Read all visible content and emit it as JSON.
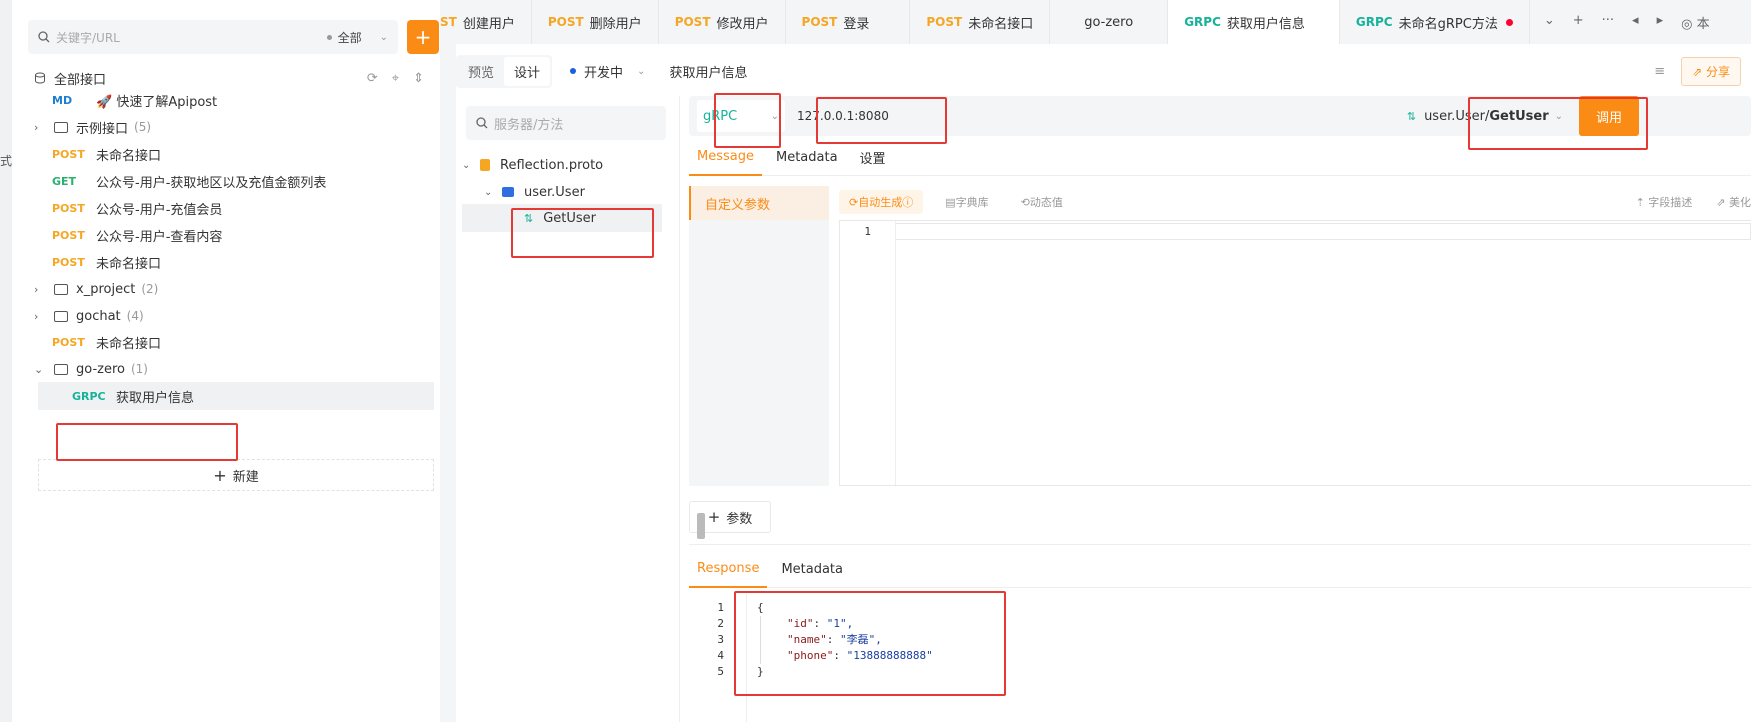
{
  "sidebar": {
    "search_placeholder": "关键字/URL",
    "scope_label": "全部",
    "add_label": "+",
    "tree_title": "全部接口",
    "items": [
      {
        "method": "MD",
        "label": "🚀 快速了解Apipost"
      },
      {
        "folder": true,
        "label": "示例接口",
        "count": "(5)"
      },
      {
        "method": "POST",
        "label": "未命名接口"
      },
      {
        "method": "GET",
        "label": "公众号-用户-获取地区以及充值金额列表"
      },
      {
        "method": "POST",
        "label": "公众号-用户-充值会员"
      },
      {
        "method": "POST",
        "label": "公众号-用户-查看内容"
      },
      {
        "method": "POST",
        "label": "未命名接口"
      },
      {
        "folder": true,
        "label": "x_project",
        "count": "(2)"
      },
      {
        "folder": true,
        "label": "gochat",
        "count": "(4)"
      },
      {
        "method": "POST",
        "label": "未命名接口"
      },
      {
        "folder": true,
        "open": true,
        "label": "go-zero",
        "count": "(1)"
      },
      {
        "method": "GRPC",
        "label": "获取用户信息"
      }
    ],
    "new_label": "新建"
  },
  "left_strip": {
    "char1": "式",
    "char2": "丨"
  },
  "tabs": [
    {
      "method": "ST",
      "label": "创建用户"
    },
    {
      "method": "POST",
      "label": "删除用户"
    },
    {
      "method": "POST",
      "label": "修改用户"
    },
    {
      "method": "POST",
      "label": "登录"
    },
    {
      "method": "POST",
      "label": "未命名接口"
    },
    {
      "method": "",
      "label": "go-zero"
    },
    {
      "method": "GRPC",
      "label": "获取用户信息",
      "active": true
    },
    {
      "method": "GRPC",
      "label": "未命名gRPC方法",
      "dirty": true
    }
  ],
  "tab_tools": {
    "more": "⌄",
    "add": "+",
    "dots": "···",
    "prev": "◂",
    "next": "▸",
    "env": "◎ 本"
  },
  "subbar": {
    "preview": "预览",
    "design": "设计",
    "status": "开发中",
    "request_name": "获取用户信息",
    "share": "分享"
  },
  "proto": {
    "search_placeholder": "服务器/方法",
    "file": "Reflection.proto",
    "service": "user.User",
    "method": "GetUser"
  },
  "request": {
    "protocol": "gRPC",
    "host": "127.0.0.1:8080",
    "method_prefix": "user.User/",
    "method_name": "GetUser",
    "invoke": "调用",
    "tabs": [
      "Message",
      "Metadata",
      "设置"
    ],
    "param_tab": "自定义参数",
    "auto_generate": "自动生成",
    "dictionary": "字典库",
    "dynamic": "动态值",
    "field_desc": "字段描述",
    "beautify": "美化",
    "editor_line": "1",
    "add_param": "参数"
  },
  "response": {
    "tabs": [
      "Response",
      "Metadata"
    ],
    "lines": [
      "1",
      "2",
      "3",
      "4",
      "5"
    ],
    "open": "{",
    "close": "}",
    "fields": [
      {
        "key": "\"id\"",
        "value": "\"1\","
      },
      {
        "key": "\"name\"",
        "value": "\"李磊\","
      },
      {
        "key": "\"phone\"",
        "value": "\"13888888888\""
      }
    ]
  }
}
